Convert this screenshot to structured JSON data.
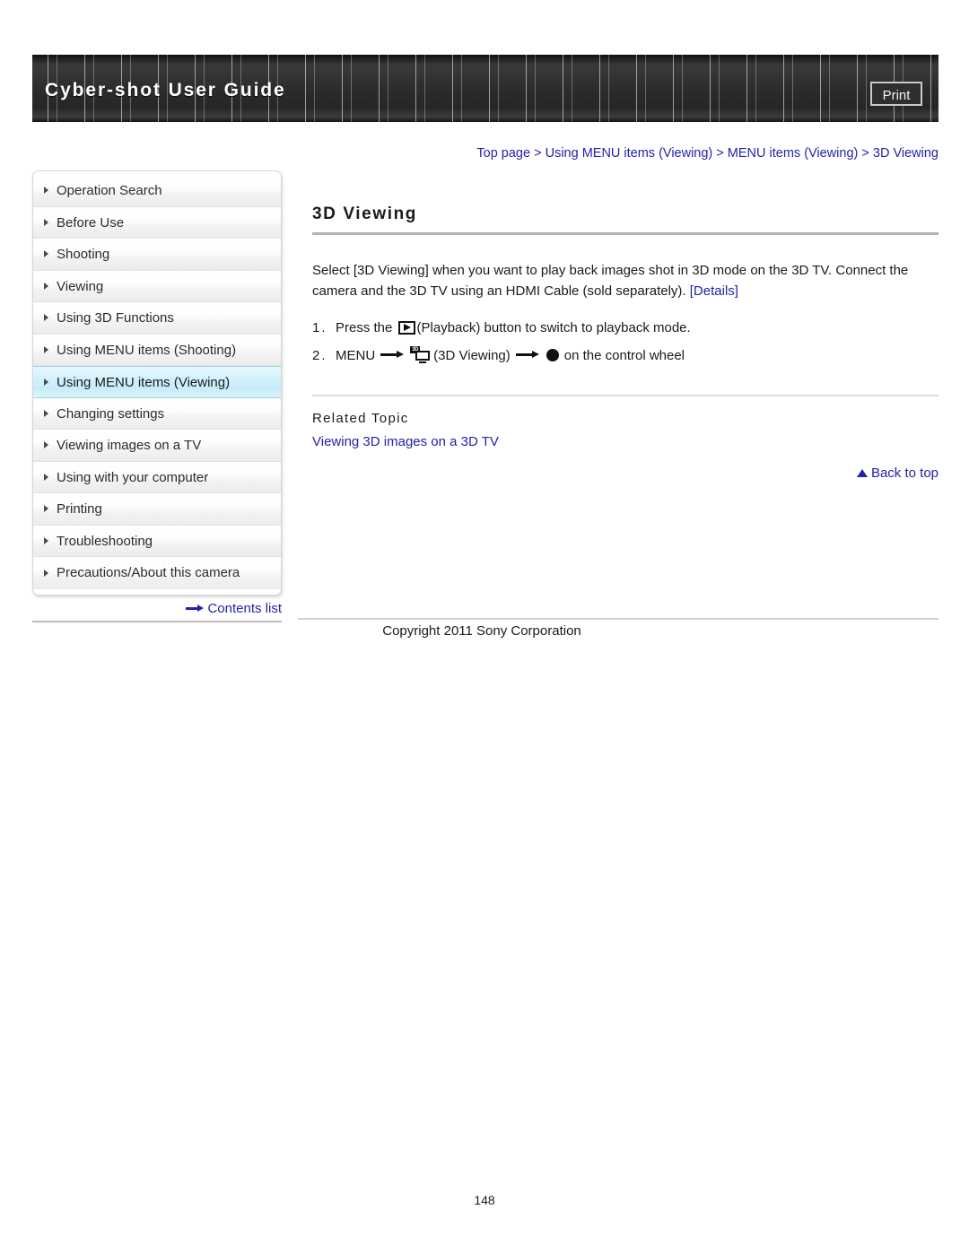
{
  "header": {
    "title": "Cyber-shot User Guide",
    "print_label": "Print"
  },
  "breadcrumb": {
    "items": [
      "Top page",
      "Using MENU items (Viewing)",
      "MENU items (Viewing)",
      "3D Viewing"
    ],
    "separator": ">",
    "full_text": "Top page > Using MENU items (Viewing) > MENU items (Viewing) > 3D Viewing"
  },
  "sidebar": {
    "items": [
      {
        "label": "Operation Search",
        "selected": false
      },
      {
        "label": "Before Use",
        "selected": false
      },
      {
        "label": "Shooting",
        "selected": false
      },
      {
        "label": "Viewing",
        "selected": false
      },
      {
        "label": "Using 3D Functions",
        "selected": false
      },
      {
        "label": "Using MENU items (Shooting)",
        "selected": false
      },
      {
        "label": "Using MENU items (Viewing)",
        "selected": true
      },
      {
        "label": "Changing settings",
        "selected": false
      },
      {
        "label": "Viewing images on a TV",
        "selected": false
      },
      {
        "label": "Using with your computer",
        "selected": false
      },
      {
        "label": "Printing",
        "selected": false
      },
      {
        "label": "Troubleshooting",
        "selected": false
      },
      {
        "label": "Precautions/About this camera",
        "selected": false
      }
    ],
    "contents_list_label": "Contents list"
  },
  "main": {
    "title": "3D Viewing",
    "intro_text_1": "Select [3D Viewing] when you want to play back images shot in 3D mode on the 3D TV. Connect the camera and the 3D TV using an HDMI Cable (sold separately). ",
    "details_link": "[Details]",
    "steps": [
      {
        "number": "1.",
        "text_before_icon": "Press the ",
        "icon": "playback-icon",
        "text_after_icon": "(Playback) button to switch to playback mode."
      },
      {
        "number": "2.",
        "menu_label": "MENU",
        "icon": "3d-viewing-icon",
        "icon_badge": "3D",
        "mode_label": "(3D Viewing)",
        "wheel_label": "on the control wheel"
      }
    ],
    "related_topic_heading": "Related Topic",
    "related_topic_link": "Viewing 3D images on a 3D TV",
    "back_to_top_label": "Back to top"
  },
  "footer": {
    "copyright": "Copyright 2011 Sony Corporation",
    "page_number": "148"
  },
  "colors": {
    "link": "#2323a8",
    "selected_nav": "#c6ecf9",
    "banner_dark": "#2c2c2c",
    "text": "#1a1a1a"
  }
}
